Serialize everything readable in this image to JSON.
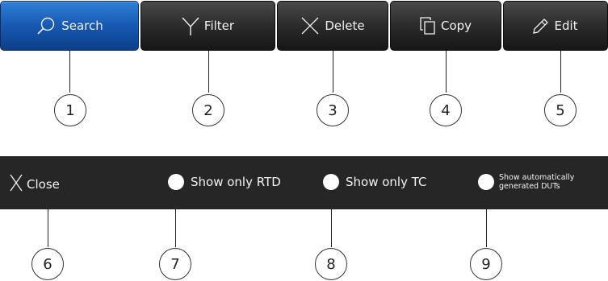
{
  "toolbar": {
    "buttons": [
      {
        "label": "Search",
        "icon": "search-icon",
        "active": true
      },
      {
        "label": "Filter",
        "icon": "filter-icon",
        "active": false
      },
      {
        "label": "Delete",
        "icon": "delete-icon",
        "active": false
      },
      {
        "label": "Copy",
        "icon": "copy-icon",
        "active": false
      },
      {
        "label": "Edit",
        "icon": "pencil-icon",
        "active": false
      }
    ]
  },
  "bar2": {
    "close_label": "Close",
    "show_rtd_label": "Show only RTD",
    "show_tc_label": "Show only TC",
    "auto_duts_line1": "Show automatically",
    "auto_duts_line2": "generated DUTs"
  },
  "callouts": [
    "1",
    "2",
    "3",
    "4",
    "5",
    "6",
    "7",
    "8",
    "9"
  ],
  "colors": {
    "active_button": "#1759b2",
    "button": "#2b2b2b",
    "bar_background": "#262626",
    "text_light": "#f2f2f2"
  }
}
